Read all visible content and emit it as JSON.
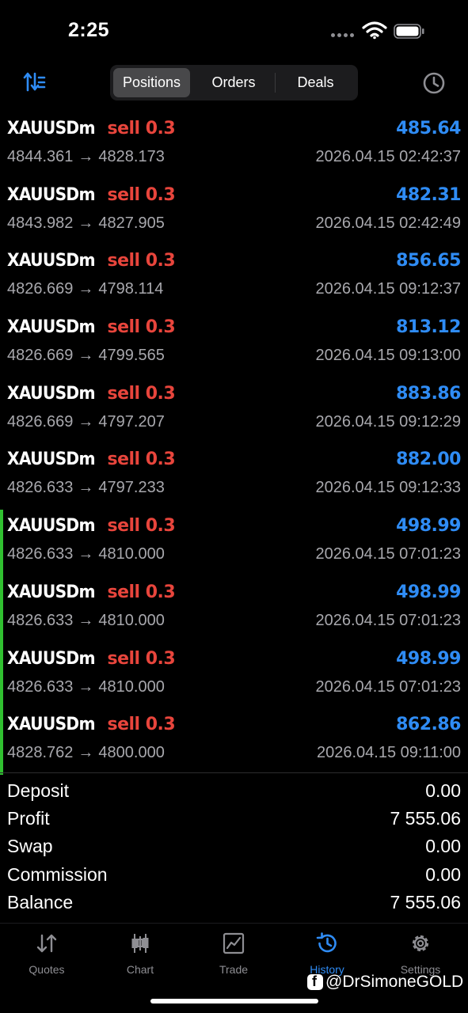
{
  "status_bar": {
    "time": "2:25"
  },
  "header": {
    "tabs": [
      {
        "label": "Positions",
        "active": true
      },
      {
        "label": "Orders",
        "active": false
      },
      {
        "label": "Deals",
        "active": false
      }
    ],
    "sort_icon": "sort-icon",
    "period_icon": "clock-icon"
  },
  "deals": [
    {
      "symbol": "XAUUSDm",
      "side": "sell 0.3",
      "profit": "485.64",
      "open": "4844.361",
      "close": "4828.173",
      "time": "2026.04.15 02:42:37",
      "marked": false
    },
    {
      "symbol": "XAUUSDm",
      "side": "sell 0.3",
      "profit": "482.31",
      "open": "4843.982",
      "close": "4827.905",
      "time": "2026.04.15 02:42:49",
      "marked": false
    },
    {
      "symbol": "XAUUSDm",
      "side": "sell 0.3",
      "profit": "856.65",
      "open": "4826.669",
      "close": "4798.114",
      "time": "2026.04.15 09:12:37",
      "marked": false
    },
    {
      "symbol": "XAUUSDm",
      "side": "sell 0.3",
      "profit": "813.12",
      "open": "4826.669",
      "close": "4799.565",
      "time": "2026.04.15 09:13:00",
      "marked": false
    },
    {
      "symbol": "XAUUSDm",
      "side": "sell 0.3",
      "profit": "883.86",
      "open": "4826.669",
      "close": "4797.207",
      "time": "2026.04.15 09:12:29",
      "marked": false
    },
    {
      "symbol": "XAUUSDm",
      "side": "sell 0.3",
      "profit": "882.00",
      "open": "4826.633",
      "close": "4797.233",
      "time": "2026.04.15 09:12:33",
      "marked": false
    },
    {
      "symbol": "XAUUSDm",
      "side": "sell 0.3",
      "profit": "498.99",
      "open": "4826.633",
      "close": "4810.000",
      "time": "2026.04.15 07:01:23",
      "marked": true
    },
    {
      "symbol": "XAUUSDm",
      "side": "sell 0.3",
      "profit": "498.99",
      "open": "4826.633",
      "close": "4810.000",
      "time": "2026.04.15 07:01:23",
      "marked": true
    },
    {
      "symbol": "XAUUSDm",
      "side": "sell 0.3",
      "profit": "498.99",
      "open": "4826.633",
      "close": "4810.000",
      "time": "2026.04.15 07:01:23",
      "marked": true
    },
    {
      "symbol": "XAUUSDm",
      "side": "sell 0.3",
      "profit": "862.86",
      "open": "4828.762",
      "close": "4800.000",
      "time": "2026.04.15 09:11:00",
      "marked": true
    }
  ],
  "summary": [
    {
      "label": "Deposit",
      "value": "0.00"
    },
    {
      "label": "Profit",
      "value": "7 555.06"
    },
    {
      "label": "Swap",
      "value": "0.00"
    },
    {
      "label": "Commission",
      "value": "0.00"
    },
    {
      "label": "Balance",
      "value": "7 555.06"
    }
  ],
  "tabbar": [
    {
      "label": "Quotes",
      "icon": "quotes-icon",
      "active": false
    },
    {
      "label": "Chart",
      "icon": "chart-icon",
      "active": false
    },
    {
      "label": "Trade",
      "icon": "trade-icon",
      "active": false
    },
    {
      "label": "History",
      "icon": "history-icon",
      "active": true
    },
    {
      "label": "Settings",
      "icon": "settings-icon",
      "active": false
    }
  ],
  "watermark": "@DrSimoneGOLD",
  "colors": {
    "sell": "#e8453c",
    "profit": "#2f8cf5",
    "marker": "#30c030",
    "active_tab": "#2f8cf5"
  }
}
